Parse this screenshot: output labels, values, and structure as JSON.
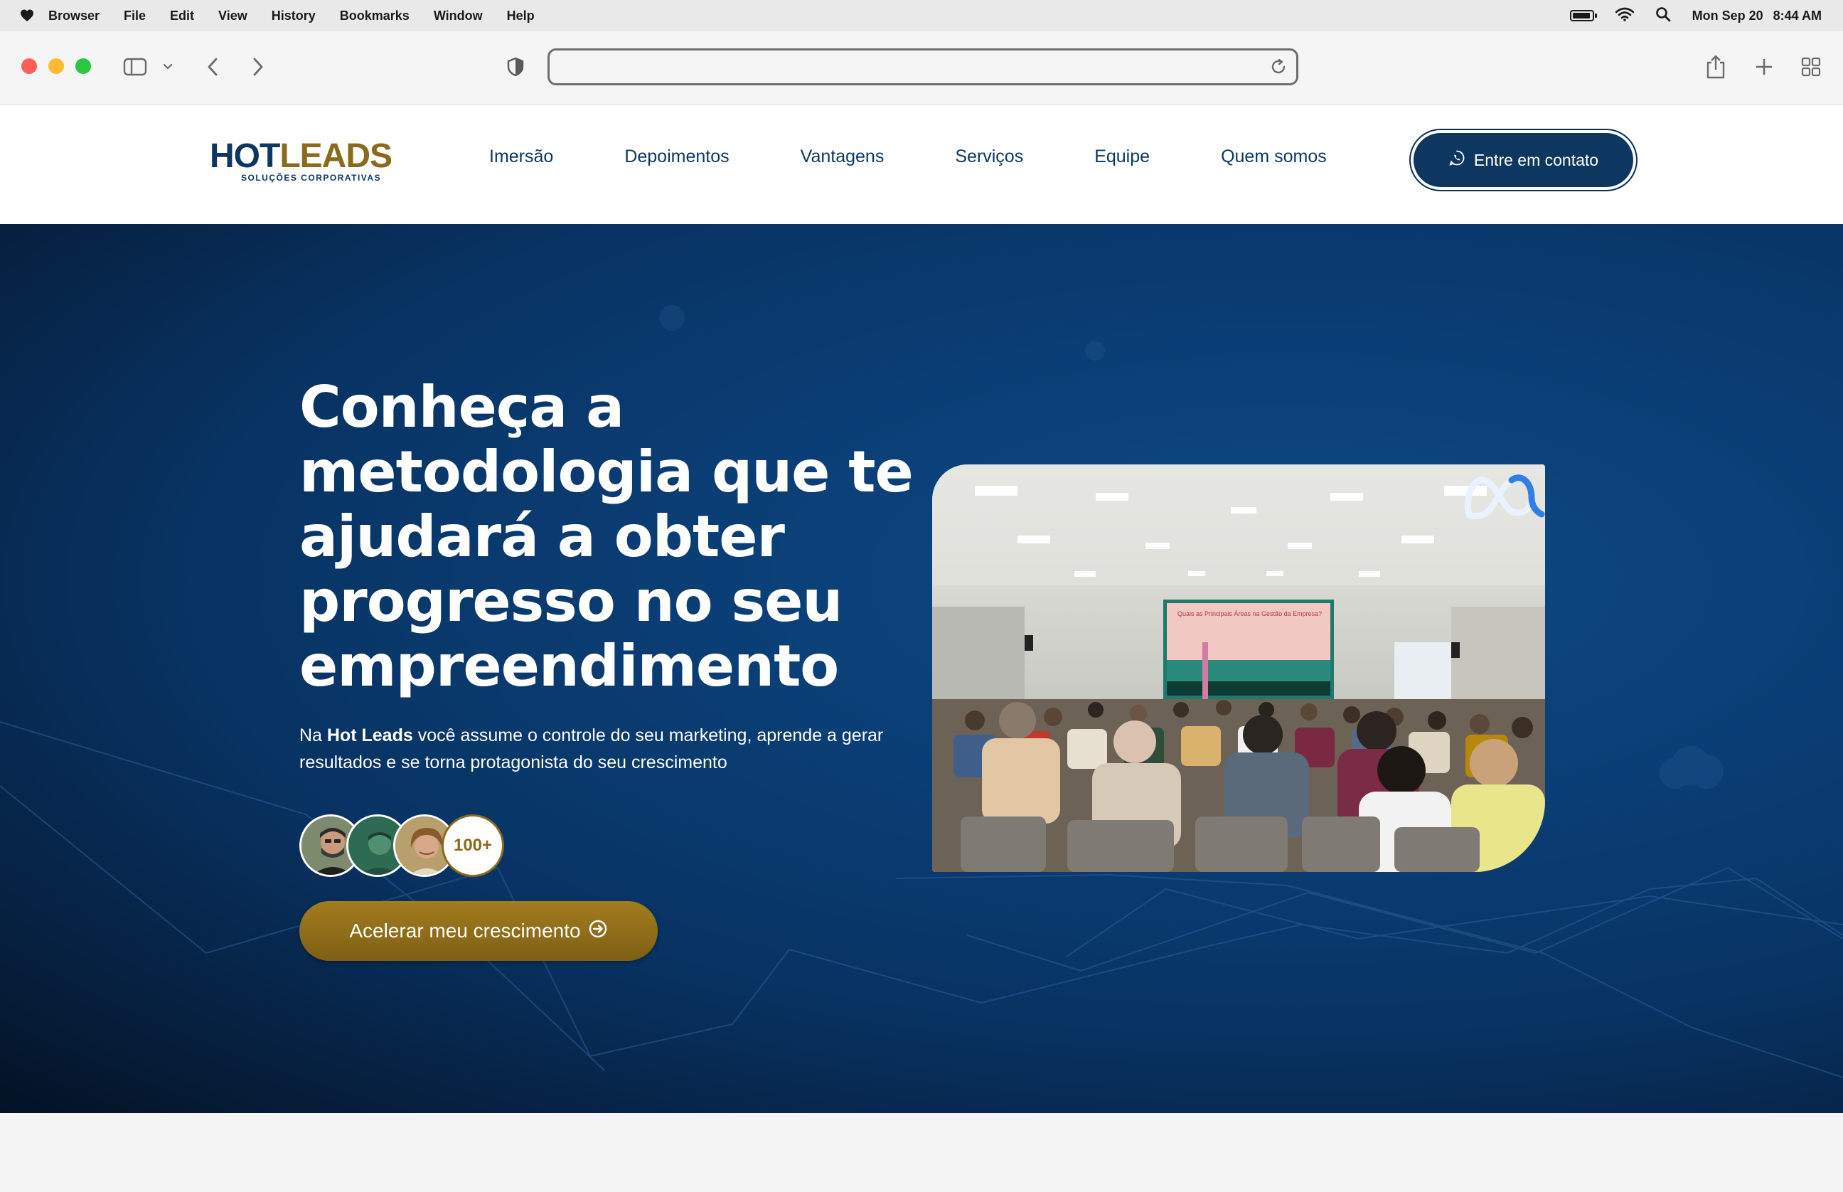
{
  "menubar": {
    "items": [
      "Browser",
      "File",
      "Edit",
      "View",
      "History",
      "Bookmarks",
      "Window",
      "Help"
    ],
    "date": "Mon Sep 20",
    "time": "8:44 AM"
  },
  "browser": {
    "url": "",
    "icons": [
      "sidebar-icon",
      "chevron-down-icon",
      "back-icon",
      "forward-icon",
      "shield-icon",
      "reload-icon",
      "share-icon",
      "new-tab-icon",
      "tab-overview-icon"
    ]
  },
  "site": {
    "logo": {
      "main_a": "HOT",
      "main_b": "LEADS",
      "sub": "SOLUÇÕES CORPORATIVAS"
    },
    "nav": [
      "Imersão",
      "Depoimentos",
      "Vantagens",
      "Serviços",
      "Equipe",
      "Quem somos"
    ],
    "cta_label": "Entre em contato"
  },
  "hero": {
    "title": "Conheça a metodologia que te ajudará a obter progresso no seu empreendimento",
    "desc_prefix": "Na ",
    "desc_brand": "Hot Leads",
    "desc_suffix": " você assume o controle do seu marketing, aprende a gerar resultados e se torna protagonista do seu crescimento",
    "avatars_count": "100+",
    "button_label": "Acelerar meu crescimento",
    "photo_screen_title": "Quais as Principais Áreas na Gestão da Empresa?"
  },
  "colors": {
    "brand_navy": "#0d3761",
    "brand_gold": "#8a6a1c",
    "hero_bg": "#0a3d74"
  }
}
